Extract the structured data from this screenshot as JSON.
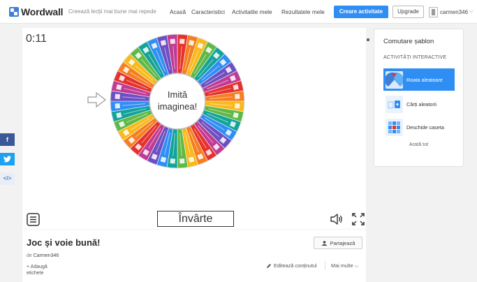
{
  "header": {
    "logo_text": "Wordwall",
    "tagline": "Creează lecții mai bune mai repede",
    "nav": [
      {
        "label": "Acasă"
      },
      {
        "label": "Caracteristici"
      },
      {
        "label": "Activitatile mele"
      },
      {
        "label": "Rezultatele mele"
      }
    ],
    "create_label": "Creare activitate",
    "upgrade_label": "Upgrade",
    "username": "carmen346",
    "caret": "⌵"
  },
  "activity": {
    "timer": "0:11",
    "center_text_line1": "Imită",
    "center_text_line2": "imaginea!",
    "spin_label": "Învârte",
    "segment_count": 40,
    "segment_colors": [
      "#e5322d",
      "#f47e20",
      "#f9b91b",
      "#5fb946",
      "#13a39a",
      "#2f8ef4",
      "#6c4fc2",
      "#c03b93"
    ]
  },
  "social": {
    "facebook": "f",
    "twitter": "t",
    "embed": "</>"
  },
  "templates": {
    "title": "Comutare șablon",
    "subtitle": "ACTIVITĂȚI INTERACTIVE",
    "items": [
      {
        "label": "Roata aleatoare",
        "icon": "wheel-icon",
        "active": true
      },
      {
        "label": "Cărți aleatorii",
        "icon": "cards-icon",
        "active": false
      },
      {
        "label": "Deschide caseta",
        "icon": "boxes-icon",
        "active": false
      }
    ],
    "show_all": "Arată tot"
  },
  "info": {
    "title": "Joc și voie bună!",
    "by_prefix": "de",
    "author": "Carmen346",
    "add_tags": "+ Adaugă etichete",
    "share_label": "Partajează",
    "edit_label": "Editează conținutul",
    "more_label": "Mai multe ⌵"
  }
}
